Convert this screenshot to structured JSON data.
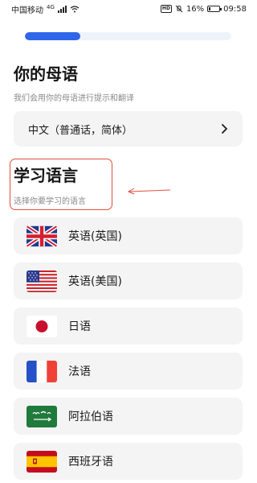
{
  "status_bar": {
    "carrier": "中国移动",
    "network": "4G",
    "battery_level": "16%",
    "time": "09:58",
    "hd": "HD"
  },
  "progress": {
    "value": 0.27
  },
  "native_section": {
    "title": "你的母语",
    "subtitle": "我们会用你的母语进行提示和翻译",
    "selected_language": "中文（普通话，简体）"
  },
  "learn_section": {
    "title": "学习语言",
    "subtitle": "选择你要学习的语言"
  },
  "languages": [
    {
      "name": "英语(英国)",
      "flag_icon": "uk-flag-icon"
    },
    {
      "name": "英语(美国)",
      "flag_icon": "us-flag-icon"
    },
    {
      "name": "日语",
      "flag_icon": "japan-flag-icon"
    },
    {
      "name": "法语",
      "flag_icon": "france-flag-icon"
    },
    {
      "name": "阿拉伯语",
      "flag_icon": "arabic-flag-icon"
    },
    {
      "name": "西班牙语",
      "flag_icon": "spain-flag-icon"
    }
  ],
  "colors": {
    "accent": "#2f66ea",
    "highlight": "#e0503a",
    "card": "#f4f4f4"
  }
}
